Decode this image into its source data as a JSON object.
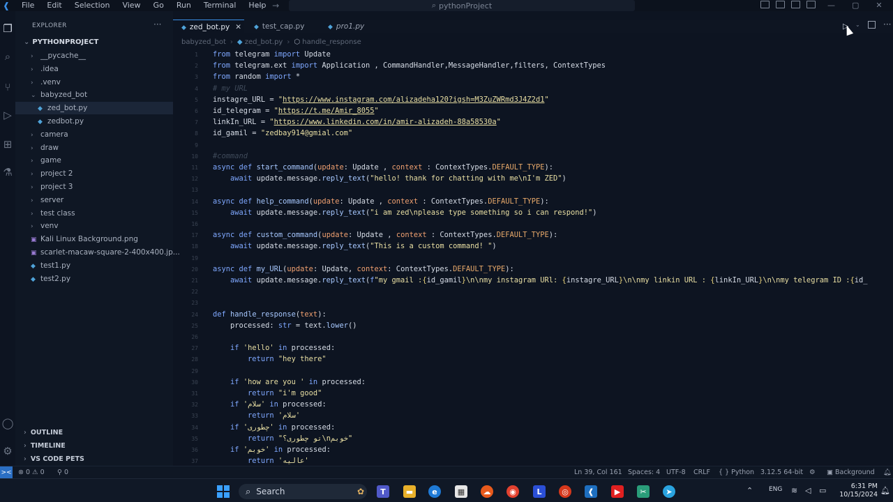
{
  "titlebar": {
    "menu": [
      "File",
      "Edit",
      "Selection",
      "View",
      "Go",
      "Run",
      "Terminal",
      "Help"
    ],
    "search": "pythonProject",
    "nav_back": "←",
    "nav_forward": "→"
  },
  "sidebar": {
    "header": "EXPLORER",
    "project": "PYTHONPROJECT",
    "items": [
      {
        "label": "__pycache__",
        "kind": "folder",
        "indent": 0
      },
      {
        "label": ".idea",
        "kind": "folder",
        "indent": 0
      },
      {
        "label": ".venv",
        "kind": "folder",
        "indent": 0
      },
      {
        "label": "babyzed_bot",
        "kind": "folder-open",
        "indent": 0
      },
      {
        "label": "zed_bot.py",
        "kind": "py",
        "indent": 1,
        "selected": true
      },
      {
        "label": "zedbot.py",
        "kind": "py",
        "indent": 1
      },
      {
        "label": "camera",
        "kind": "folder",
        "indent": 0
      },
      {
        "label": "draw",
        "kind": "folder",
        "indent": 0
      },
      {
        "label": "game",
        "kind": "folder",
        "indent": 0
      },
      {
        "label": "project 2",
        "kind": "folder",
        "indent": 0
      },
      {
        "label": "project 3",
        "kind": "folder",
        "indent": 0
      },
      {
        "label": "server",
        "kind": "folder",
        "indent": 0
      },
      {
        "label": "test class",
        "kind": "folder",
        "indent": 0
      },
      {
        "label": "venv",
        "kind": "folder",
        "indent": 0
      },
      {
        "label": "Kali Linux Background.png",
        "kind": "img",
        "indent": 0
      },
      {
        "label": "scarlet-macaw-square-2-400x400.jp...",
        "kind": "img",
        "indent": 0
      },
      {
        "label": "test1.py",
        "kind": "py",
        "indent": 0
      },
      {
        "label": "test2.py",
        "kind": "py",
        "indent": 0
      }
    ],
    "sections": [
      "OUTLINE",
      "TIMELINE",
      "VS CODE PETS"
    ]
  },
  "tabs": [
    {
      "label": "zed_bot.py",
      "active": true
    },
    {
      "label": "test_cap.py",
      "active": false
    },
    {
      "label": "pro1.py",
      "active": false,
      "italic": true
    }
  ],
  "breadcrumb": [
    "babyzed_bot",
    "zed_bot.py",
    "handle_response"
  ],
  "code": [
    {
      "n": "1",
      "html": "<span class='kw'>from</span> telegram <span class='kw'>import</span> Update"
    },
    {
      "n": "2",
      "html": "<span class='kw'>from</span> telegram.ext <span class='kw'>import</span> Application , CommandHandler,MessageHandler,filters, ContextTypes"
    },
    {
      "n": "3",
      "html": "<span class='kw'>from</span> random <span class='kw'>import</span> *"
    },
    {
      "n": "4",
      "html": "<span class='cm'># my URL</span>"
    },
    {
      "n": "5",
      "html": "instagre_URL = <span class='str'>\"</span><span class='strl'>https://www.instagram.com/alizadeha120?igsh=M3ZuZWRmd3J4Z2d1</span><span class='str'>\"</span>"
    },
    {
      "n": "6",
      "html": "id_telegram = <span class='str'>\"</span><span class='strl'>https://t.me/Amir_8055</span><span class='str'>\"</span>"
    },
    {
      "n": "7",
      "html": "linkIn_URL = <span class='str'>\"</span><span class='strl'>https://www.linkedin.com/in/amir-alizadeh-88a58530a</span><span class='str'>\"</span>"
    },
    {
      "n": "8",
      "html": "id_gamil = <span class='str'>\"zedbay914@gmial.com\"</span>"
    },
    {
      "n": "9",
      "html": ""
    },
    {
      "n": "10",
      "html": "<span class='cm'>#command</span>"
    },
    {
      "n": "11",
      "html": "<span class='kw'>async def</span> <span class='fn'>start_command</span>(<span class='pm'>update</span>: Update , <span class='pm'>context</span> : ContextTypes.<span class='ct'>DEFAULT_TYPE</span>):"
    },
    {
      "n": "12",
      "html": "    <span class='kw'>await</span> update.message.<span class='fn'>reply_text</span>(<span class='str'>\"hello! thank for chatting with me\\nI'm ZED\"</span>)"
    },
    {
      "n": "13",
      "html": ""
    },
    {
      "n": "14",
      "html": "<span class='kw'>async def</span> <span class='fn'>help_command</span>(<span class='pm'>update</span>: Update , <span class='pm'>context</span> : ContextTypes.<span class='ct'>DEFAULT_TYPE</span>):"
    },
    {
      "n": "15",
      "html": "    <span class='kw'>await</span> update.message.<span class='fn'>reply_text</span>(<span class='str'>\"i am zed\\nplease type something so i can respond!\"</span>)"
    },
    {
      "n": "16",
      "html": ""
    },
    {
      "n": "17",
      "html": "<span class='kw'>async def</span> <span class='fn'>custom_command</span>(<span class='pm'>update</span>: Update , <span class='pm'>context</span> : ContextTypes.<span class='ct'>DEFAULT_TYPE</span>):"
    },
    {
      "n": "18",
      "html": "    <span class='kw'>await</span> update.message.<span class='fn'>reply_text</span>(<span class='str'>\"This is a custom command! \"</span>)"
    },
    {
      "n": "19",
      "html": ""
    },
    {
      "n": "20",
      "html": "<span class='kw'>async def</span> <span class='fn'>my_URL</span>(<span class='pm'>update</span>: Update, <span class='pm'>context</span>: ContextTypes.<span class='ct'>DEFAULT_TYPE</span>):"
    },
    {
      "n": "21",
      "html": "    <span class='kw'>await</span> update.message.<span class='fn'>reply_text</span>(<span class='kw'>f</span><span class='str'>\"my gmail :</span><span class='br'>{</span>id_gamil<span class='br'>}</span><span class='str'>\\n\\nmy instagram URl: </span><span class='br'>{</span>instagre_URL<span class='br'>}</span><span class='str'>\\n\\nmy linkin URL : </span><span class='br'>{</span>linkIn_URL<span class='br'>}</span><span class='str'>\\n\\nmy telegram ID :</span><span class='br'>{</span>id_"
    },
    {
      "n": "22",
      "html": ""
    },
    {
      "n": "23",
      "html": ""
    },
    {
      "n": "24",
      "html": "<span class='kw'>def</span> <span class='fn'>handle_response</span>(<span class='pm'>text</span>):"
    },
    {
      "n": "25",
      "html": "    processed: <span class='kw'>str</span> = text.<span class='fn'>lower</span>()"
    },
    {
      "n": "26",
      "html": ""
    },
    {
      "n": "27",
      "html": "    <span class='kw'>if</span> <span class='str'>'hello'</span> <span class='kw'>in</span> processed:"
    },
    {
      "n": "28",
      "html": "        <span class='kw'>return</span> <span class='str'>\"hey there\"</span>"
    },
    {
      "n": "29",
      "html": ""
    },
    {
      "n": "30",
      "html": "    <span class='kw'>if</span> <span class='str'>'how are you '</span> <span class='kw'>in</span> processed:"
    },
    {
      "n": "31",
      "html": "        <span class='kw'>return</span> <span class='str'>\"i'm good\"</span>"
    },
    {
      "n": "32",
      "html": "    <span class='kw'>if</span> <span class='str'>'سلام'</span> <span class='kw'>in</span> processed:"
    },
    {
      "n": "33",
      "html": "        <span class='kw'>return</span> <span class='str'>'سلام'</span>"
    },
    {
      "n": "34",
      "html": "    <span class='kw'>if</span> <span class='str'>'چطوری'</span> <span class='kw'>in</span> processed:"
    },
    {
      "n": "35",
      "html": "        <span class='kw'>return</span> <span class='str'>\"تو چطوری؟\\nخوبم\"</span>"
    },
    {
      "n": "36",
      "html": "    <span class='kw'>if</span> <span class='str'>'خوبم'</span> <span class='kw'>in</span> processed:"
    },
    {
      "n": "37",
      "html": "        <span class='kw'>return</span> <span class='str'>'عالیه'</span>"
    }
  ],
  "status": {
    "remote": "><",
    "errors": "⊗ 0 ⚠ 0",
    "ports": "⚲ 0",
    "position": "Ln 39, Col 161",
    "spaces": "Spaces: 4",
    "encoding": "UTF-8",
    "eol": "CRLF",
    "language": "{ } Python",
    "interpreter": "3.12.5 64-bit",
    "background": "Background"
  },
  "taskbar": {
    "search_label": "Search",
    "clock_time": "6:31 PM",
    "clock_date": "10/15/2024",
    "lang": "ENG"
  }
}
